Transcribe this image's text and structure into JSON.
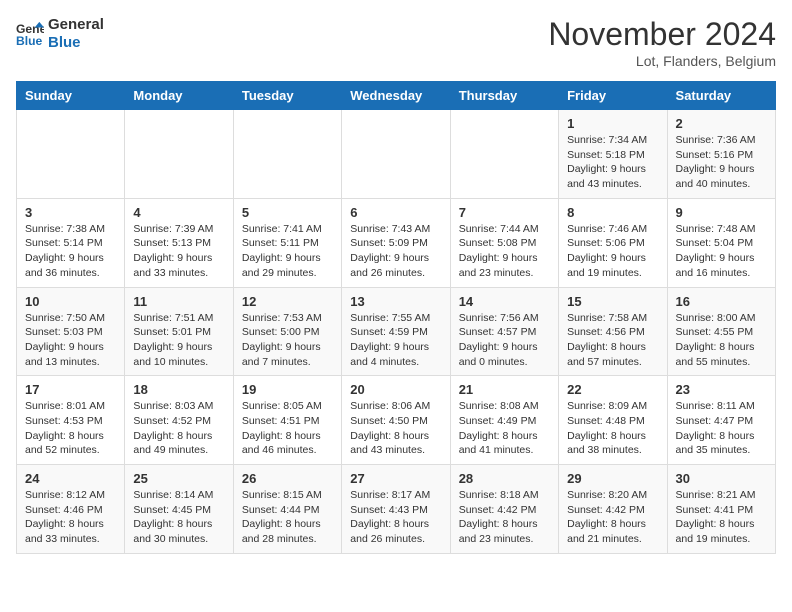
{
  "header": {
    "logo_line1": "General",
    "logo_line2": "Blue",
    "month_title": "November 2024",
    "location": "Lot, Flanders, Belgium"
  },
  "weekdays": [
    "Sunday",
    "Monday",
    "Tuesday",
    "Wednesday",
    "Thursday",
    "Friday",
    "Saturday"
  ],
  "weeks": [
    [
      {
        "day": "",
        "info": ""
      },
      {
        "day": "",
        "info": ""
      },
      {
        "day": "",
        "info": ""
      },
      {
        "day": "",
        "info": ""
      },
      {
        "day": "",
        "info": ""
      },
      {
        "day": "1",
        "info": "Sunrise: 7:34 AM\nSunset: 5:18 PM\nDaylight: 9 hours and 43 minutes."
      },
      {
        "day": "2",
        "info": "Sunrise: 7:36 AM\nSunset: 5:16 PM\nDaylight: 9 hours and 40 minutes."
      }
    ],
    [
      {
        "day": "3",
        "info": "Sunrise: 7:38 AM\nSunset: 5:14 PM\nDaylight: 9 hours and 36 minutes."
      },
      {
        "day": "4",
        "info": "Sunrise: 7:39 AM\nSunset: 5:13 PM\nDaylight: 9 hours and 33 minutes."
      },
      {
        "day": "5",
        "info": "Sunrise: 7:41 AM\nSunset: 5:11 PM\nDaylight: 9 hours and 29 minutes."
      },
      {
        "day": "6",
        "info": "Sunrise: 7:43 AM\nSunset: 5:09 PM\nDaylight: 9 hours and 26 minutes."
      },
      {
        "day": "7",
        "info": "Sunrise: 7:44 AM\nSunset: 5:08 PM\nDaylight: 9 hours and 23 minutes."
      },
      {
        "day": "8",
        "info": "Sunrise: 7:46 AM\nSunset: 5:06 PM\nDaylight: 9 hours and 19 minutes."
      },
      {
        "day": "9",
        "info": "Sunrise: 7:48 AM\nSunset: 5:04 PM\nDaylight: 9 hours and 16 minutes."
      }
    ],
    [
      {
        "day": "10",
        "info": "Sunrise: 7:50 AM\nSunset: 5:03 PM\nDaylight: 9 hours and 13 minutes."
      },
      {
        "day": "11",
        "info": "Sunrise: 7:51 AM\nSunset: 5:01 PM\nDaylight: 9 hours and 10 minutes."
      },
      {
        "day": "12",
        "info": "Sunrise: 7:53 AM\nSunset: 5:00 PM\nDaylight: 9 hours and 7 minutes."
      },
      {
        "day": "13",
        "info": "Sunrise: 7:55 AM\nSunset: 4:59 PM\nDaylight: 9 hours and 4 minutes."
      },
      {
        "day": "14",
        "info": "Sunrise: 7:56 AM\nSunset: 4:57 PM\nDaylight: 9 hours and 0 minutes."
      },
      {
        "day": "15",
        "info": "Sunrise: 7:58 AM\nSunset: 4:56 PM\nDaylight: 8 hours and 57 minutes."
      },
      {
        "day": "16",
        "info": "Sunrise: 8:00 AM\nSunset: 4:55 PM\nDaylight: 8 hours and 55 minutes."
      }
    ],
    [
      {
        "day": "17",
        "info": "Sunrise: 8:01 AM\nSunset: 4:53 PM\nDaylight: 8 hours and 52 minutes."
      },
      {
        "day": "18",
        "info": "Sunrise: 8:03 AM\nSunset: 4:52 PM\nDaylight: 8 hours and 49 minutes."
      },
      {
        "day": "19",
        "info": "Sunrise: 8:05 AM\nSunset: 4:51 PM\nDaylight: 8 hours and 46 minutes."
      },
      {
        "day": "20",
        "info": "Sunrise: 8:06 AM\nSunset: 4:50 PM\nDaylight: 8 hours and 43 minutes."
      },
      {
        "day": "21",
        "info": "Sunrise: 8:08 AM\nSunset: 4:49 PM\nDaylight: 8 hours and 41 minutes."
      },
      {
        "day": "22",
        "info": "Sunrise: 8:09 AM\nSunset: 4:48 PM\nDaylight: 8 hours and 38 minutes."
      },
      {
        "day": "23",
        "info": "Sunrise: 8:11 AM\nSunset: 4:47 PM\nDaylight: 8 hours and 35 minutes."
      }
    ],
    [
      {
        "day": "24",
        "info": "Sunrise: 8:12 AM\nSunset: 4:46 PM\nDaylight: 8 hours and 33 minutes."
      },
      {
        "day": "25",
        "info": "Sunrise: 8:14 AM\nSunset: 4:45 PM\nDaylight: 8 hours and 30 minutes."
      },
      {
        "day": "26",
        "info": "Sunrise: 8:15 AM\nSunset: 4:44 PM\nDaylight: 8 hours and 28 minutes."
      },
      {
        "day": "27",
        "info": "Sunrise: 8:17 AM\nSunset: 4:43 PM\nDaylight: 8 hours and 26 minutes."
      },
      {
        "day": "28",
        "info": "Sunrise: 8:18 AM\nSunset: 4:42 PM\nDaylight: 8 hours and 23 minutes."
      },
      {
        "day": "29",
        "info": "Sunrise: 8:20 AM\nSunset: 4:42 PM\nDaylight: 8 hours and 21 minutes."
      },
      {
        "day": "30",
        "info": "Sunrise: 8:21 AM\nSunset: 4:41 PM\nDaylight: 8 hours and 19 minutes."
      }
    ]
  ]
}
